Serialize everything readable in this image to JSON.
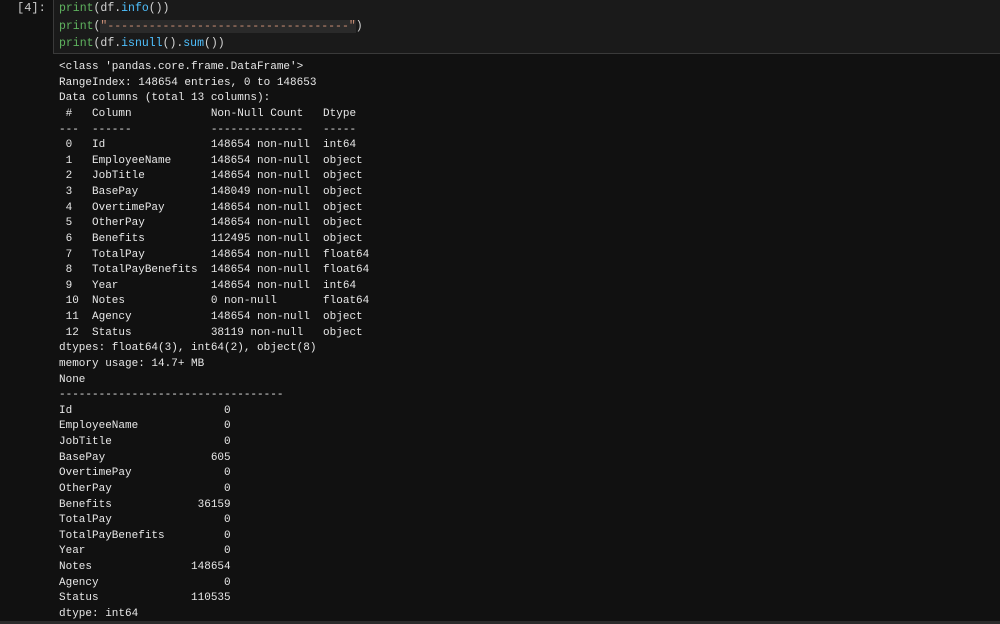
{
  "cell": {
    "prompt": "[4]:",
    "code_lines": [
      {
        "fn": "print",
        "open": "(",
        "obj": "df.",
        "method": "info",
        "rest": "())"
      },
      {
        "fn": "print",
        "open": "(",
        "string": "\"-----------------------------------\"",
        "rest": ")"
      },
      {
        "fn": "print",
        "open": "(",
        "obj": "df.",
        "method": "isnull",
        "mid": "().",
        "method2": "sum",
        "rest": "())"
      }
    ]
  },
  "output_lines": [
    "<class 'pandas.core.frame.DataFrame'>",
    "RangeIndex: 148654 entries, 0 to 148653",
    "Data columns (total 13 columns):",
    " #   Column            Non-Null Count   Dtype  ",
    "---  ------            --------------   -----  ",
    " 0   Id                148654 non-null  int64  ",
    " 1   EmployeeName      148654 non-null  object ",
    " 2   JobTitle          148654 non-null  object ",
    " 3   BasePay           148049 non-null  object ",
    " 4   OvertimePay       148654 non-null  object ",
    " 5   OtherPay          148654 non-null  object ",
    " 6   Benefits          112495 non-null  object ",
    " 7   TotalPay          148654 non-null  float64",
    " 8   TotalPayBenefits  148654 non-null  float64",
    " 9   Year              148654 non-null  int64  ",
    " 10  Notes             0 non-null       float64",
    " 11  Agency            148654 non-null  object ",
    " 12  Status            38119 non-null   object ",
    "dtypes: float64(3), int64(2), object(8)",
    "memory usage: 14.7+ MB",
    "None",
    "----------------------------------",
    "Id                       0",
    "EmployeeName             0",
    "JobTitle                 0",
    "BasePay                605",
    "OvertimePay              0",
    "OtherPay                 0",
    "Benefits             36159",
    "TotalPay                 0",
    "TotalPayBenefits         0",
    "Year                     0",
    "Notes               148654",
    "Agency                   0",
    "Status              110535",
    "dtype: int64"
  ]
}
